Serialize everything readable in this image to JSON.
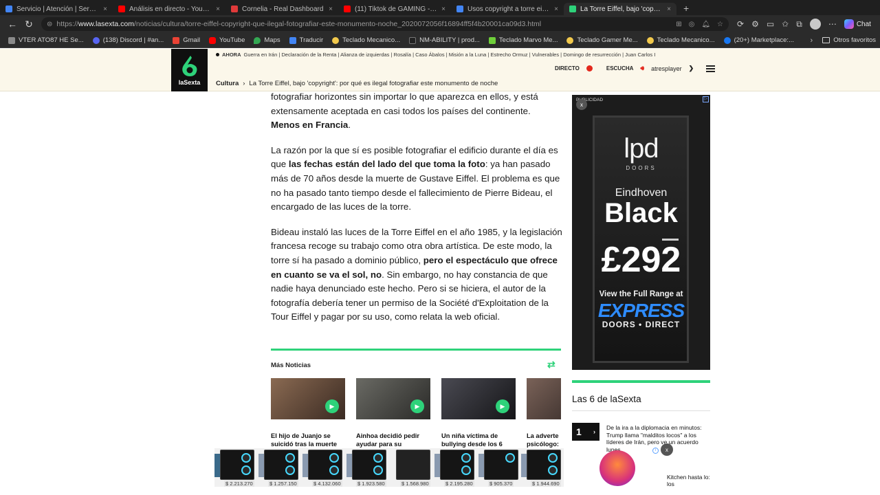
{
  "browser": {
    "tabs": [
      {
        "label": "Servicio | Atención | Servicio de",
        "active": false,
        "color": "#4285f4"
      },
      {
        "label": "Análisis en directo - YouTube",
        "active": false,
        "color": "#ff0000"
      },
      {
        "label": "Cornelia - Real Dashboard",
        "active": false,
        "color": "#e03a3a"
      },
      {
        "label": "(11) Tiktok de GAMING - YouTube",
        "active": false,
        "color": "#ff0000"
      },
      {
        "label": "Usos copyright a torre eiffel - Goo",
        "active": false,
        "color": "#4285f4"
      },
      {
        "label": "La Torre Eiffel, bajo 'copyright'",
        "active": true,
        "color": "#2ed27a"
      }
    ],
    "url_prefix": "https://",
    "url_host": "www.lasexta.com",
    "url_path": "/noticias/cultura/torre-eiffel-copyright-que-ilegal-fotografiar-este-monumento-noche_2020072056f16894ff5f4b20001ca09d3.html",
    "chat_label": "Chat",
    "bookmarks": [
      {
        "label": "VTER ATO87 HE Se...",
        "color": "#8a8a8a"
      },
      {
        "label": "(138) Discord | #an...",
        "color": "#5865f2"
      },
      {
        "label": "Gmail",
        "color": "#ea4335"
      },
      {
        "label": "YouTube",
        "color": "#ff0000"
      },
      {
        "label": "Maps",
        "color": "#34a853"
      },
      {
        "label": "Traducir",
        "color": "#4285f4"
      },
      {
        "label": "Teclado Mecanico...",
        "color": "#f2c94c"
      },
      {
        "label": "NM-ABILITY | prod...",
        "color": "#222222"
      },
      {
        "label": "Teclado Marvo Me...",
        "color": "#6fcf3a"
      },
      {
        "label": "Teclado Gamer Me...",
        "color": "#f2c94c"
      },
      {
        "label": "Teclado Mecanico...",
        "color": "#f2c94c"
      },
      {
        "label": "(20+) Marketplace:...",
        "color": "#1877f2"
      }
    ],
    "other_bookmarks": "Otros favoritos"
  },
  "site": {
    "logo_text": "laSexta",
    "ahora_label": "AHORA",
    "ticker": "Guerra en Irán | Declaración de la Renta | Alianza de izquierdas | Rosalía | Caso Ábalos | Misión a la Luna | Estrecho Ormuz | Vulnerables | Domingo de resurrección | Juan Carlos I",
    "directo_label": "DIRECTO",
    "escucha_label": "ESCUCHA",
    "atresplayer_label": "atresplayer",
    "breadcrumb_section": "Cultura",
    "breadcrumb_title": "La Torre Eiffel, bajo 'copyright': por qué es ilegal fotografiar este monumento de noche"
  },
  "article": {
    "p1_a": "fotografiar horizontes sin importar lo que aparezca en ellos, y está extensamente aceptada en casi todos los países del continente.",
    "p1_b": "Menos en Francia",
    "p1_c": ".",
    "p2_a": "La razón por la que sí es posible fotografiar el edificio durante el día es que",
    "p2_b": "las fechas están del lado del que toma la foto",
    "p2_c": ": ya han pasado más de 70 años desde la muerte de Gustave Eiffel. El problema es que no ha pasado tanto tiempo desde el fallecimiento de Pierre Bideau, el encargado de las luces de la torre.",
    "p3_a": "Bideau instaló las luces de la Torre Eiffel en el año 1985, y la legislación francesa recoge su trabajo como otra obra artística. De este modo, la torre sí ha pasado a dominio público,",
    "p3_b": "pero el espectáculo que ofrece en cuanto se va el sol, no",
    "p3_c": ". Sin embargo, no hay constancia de que nadie haya denunciado este hecho. Pero si se hiciera, el autor de la fotografía debería tener un permiso de la Société d'Exploitation de la Tour Eiffel y pagar por su uso, como relata la web oficial."
  },
  "more_news": {
    "title": "Más Noticias",
    "items": [
      {
        "title": "El hijo de Juanjo se suicidó tras la muerte",
        "thumb": "#6b4a3a"
      },
      {
        "title": "Ainhoa decidió pedir ayudar para su",
        "thumb": "#4a4a48"
      },
      {
        "title": "Un niña víctima de bullying desde los 6",
        "thumb": "#2e2e33"
      },
      {
        "title": "La adverte psicólogo:",
        "thumb": "#5a4a44"
      }
    ]
  },
  "sidebar": {
    "ad_label": "PUBLICIDAD",
    "ad_brand": "lpd",
    "ad_brand_sub": "DOORS",
    "ad_city": "Eindhoven",
    "ad_black": "Black",
    "ad_price": "£292",
    "ad_range": "View the Full Range at",
    "ad_express": "EXPRESS",
    "ad_express_sub": "DOORS • DIRECT",
    "section_title": "Las 6 de laSexta",
    "rank_number": "1",
    "rank_text": "De la ira a la diplomacia en minutos: Trump llama \"malditos locos\" a los líderes de Irán, pero ve un acuerdo lunes",
    "side_ad_text": "Kitchen hasta lo: los"
  },
  "bottom_ad": {
    "prices": [
      "$ 2.213.270",
      "$ 1.257.150",
      "$ 4.132.060",
      "$ 1.923.580",
      "$ 1.568.980",
      "$ 2.195.280",
      "$ 905.370",
      "$ 1.944.690"
    ]
  },
  "colors": {
    "brand_green": "#2ed27a",
    "live_red": "#e3281d",
    "header_bg": "#fbf7ea"
  }
}
